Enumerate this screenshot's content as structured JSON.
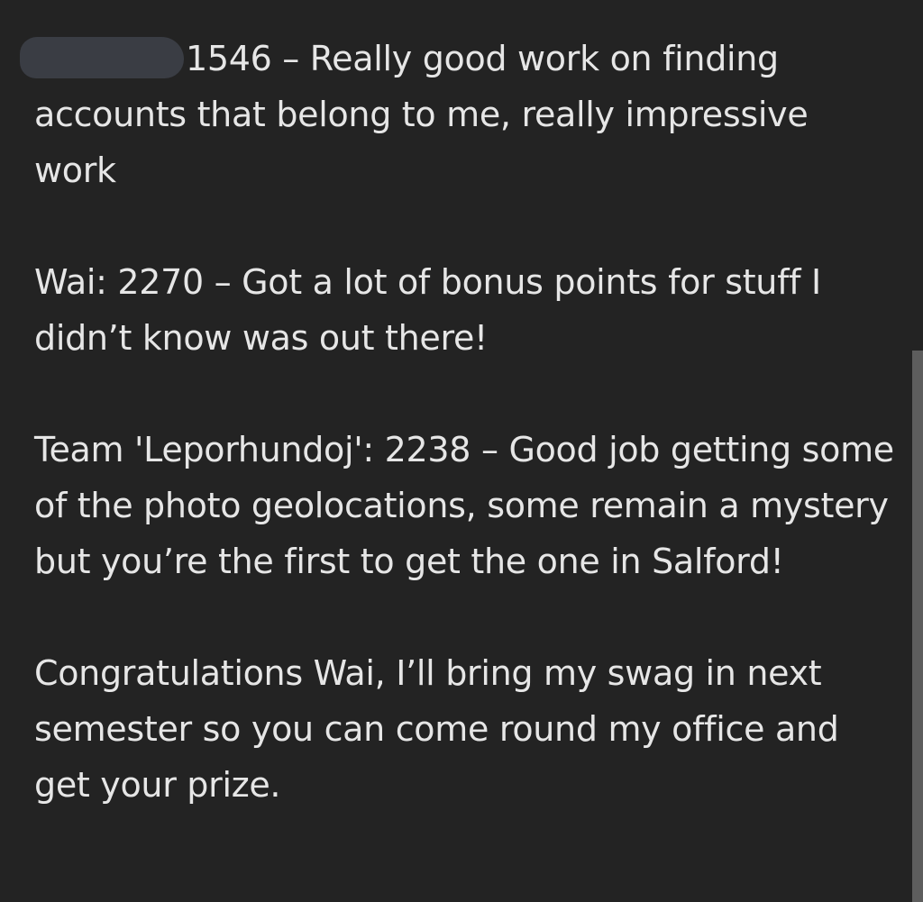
{
  "messages": [
    {
      "redacted_name": true,
      "text": "1546 – Really good work on finding accounts that belong to me, really impressive work"
    },
    {
      "text": "Wai: 2270 – Got a lot of bonus points for stuff I didn’t know was out there!"
    },
    {
      "text": "Team 'Leporhundoj': 2238 – Good job getting some of the photo geolocations, some remain a mystery but you’re the first to get the one in Salford!"
    },
    {
      "text": "Congratulations Wai, I’ll bring my swag in next semester so you can come round my office and get your prize."
    }
  ],
  "colors": {
    "background": "#232323",
    "text": "#e6e6e6",
    "redaction": "#3a3d44",
    "scrollbar": "#5d5d5d"
  }
}
